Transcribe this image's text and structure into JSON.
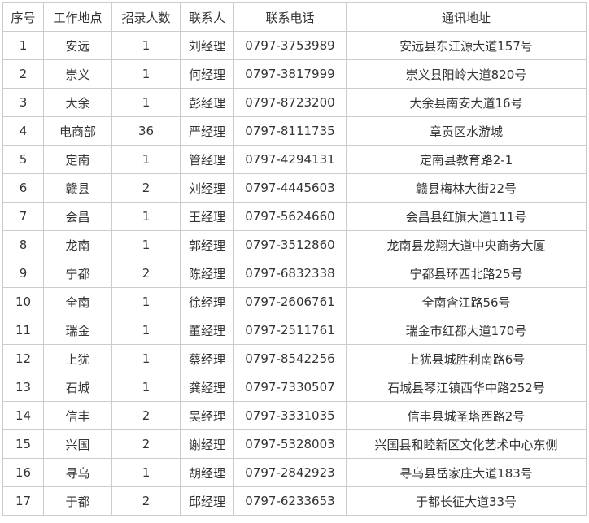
{
  "headers": [
    "序号",
    "工作地点",
    "招录人数",
    "联系人",
    "联系电话",
    "通讯地址"
  ],
  "rows": [
    [
      "1",
      "安远",
      "1",
      "刘经理",
      "0797-3753989",
      "安远县东江源大道157号"
    ],
    [
      "2",
      "崇义",
      "1",
      "何经理",
      "0797-3817999",
      "崇义县阳岭大道820号"
    ],
    [
      "3",
      "大余",
      "1",
      "彭经理",
      "0797-8723200",
      "大余县南安大道16号"
    ],
    [
      "4",
      "电商部",
      "36",
      "严经理",
      "0797-8111735",
      "章贡区水游城"
    ],
    [
      "5",
      "定南",
      "1",
      "管经理",
      "0797-4294131",
      "定南县教育路2-1"
    ],
    [
      "6",
      "赣县",
      "2",
      "刘经理",
      "0797-4445603",
      "赣县梅林大街22号"
    ],
    [
      "7",
      "会昌",
      "1",
      "王经理",
      "0797-5624660",
      "会昌县红旗大道111号"
    ],
    [
      "8",
      "龙南",
      "1",
      "郭经理",
      "0797-3512860",
      "龙南县龙翔大道中央商务大厦"
    ],
    [
      "9",
      "宁都",
      "2",
      "陈经理",
      "0797-6832338",
      "宁都县环西北路25号"
    ],
    [
      "10",
      "全南",
      "1",
      "徐经理",
      "0797-2606761",
      "全南含江路56号"
    ],
    [
      "11",
      "瑞金",
      "1",
      "董经理",
      "0797-2511761",
      "瑞金市红都大道170号"
    ],
    [
      "12",
      "上犹",
      "1",
      "蔡经理",
      "0797-8542256",
      "上犹县城胜利南路6号"
    ],
    [
      "13",
      "石城",
      "1",
      "龚经理",
      "0797-7330507",
      "石城县琴江镇西华中路252号"
    ],
    [
      "14",
      "信丰",
      "2",
      "吴经理",
      "0797-3331035",
      "信丰县城圣塔西路2号"
    ],
    [
      "15",
      "兴国",
      "2",
      "谢经理",
      "0797-5328003",
      "兴国县和睦新区文化艺术中心东侧"
    ],
    [
      "16",
      "寻乌",
      "1",
      "胡经理",
      "0797-2842923",
      "寻乌县岳家庄大道183号"
    ],
    [
      "17",
      "于都",
      "2",
      "邱经理",
      "0797-6233653",
      "于都长征大道33号"
    ]
  ]
}
